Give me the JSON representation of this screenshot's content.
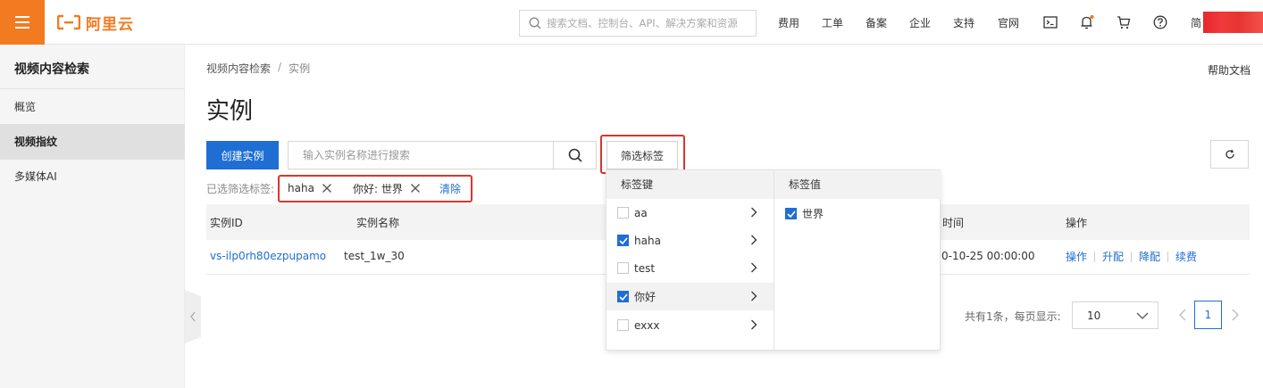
{
  "header": {
    "logo_text": "阿里云",
    "search_placeholder": "搜索文档、控制台、API、解决方案和资源",
    "nav": [
      "费用",
      "工单",
      "备案",
      "企业",
      "支持",
      "官网"
    ],
    "user_prefix": "简",
    "icons": [
      "terminal-icon",
      "bell-icon",
      "cart-icon",
      "help-icon"
    ],
    "accent_color": "#f27b21"
  },
  "sidebar": {
    "title": "视频内容检索",
    "items": [
      {
        "label": "概览",
        "active": false
      },
      {
        "label": "视频指纹",
        "active": true
      },
      {
        "label": "多媒体AI",
        "active": false
      }
    ]
  },
  "breadcrumb": {
    "parent": "视频内容检索",
    "separator": "/",
    "current": "实例"
  },
  "help_doc": "帮助文档",
  "page_title": "实例",
  "toolbar": {
    "create_label": "创建实例",
    "search_placeholder": "输入实例名称进行搜索",
    "filter_label": "筛选标签"
  },
  "selected_tags": {
    "label": "已选筛选标签:",
    "tags": [
      "haha",
      "你好: 世界"
    ],
    "clear_label": "清除"
  },
  "table": {
    "columns": [
      "实例ID",
      "实例名称",
      "时间",
      "操作"
    ],
    "rows": [
      {
        "id": "vs-ilp0rh80ezpupamo",
        "name": "test_1w_30",
        "time": "0-10-25 00:00:00",
        "ops": [
          "操作",
          "升配",
          "降配",
          "续费"
        ]
      }
    ]
  },
  "pagination": {
    "total_text": "共有1条，每页显示:",
    "page_size": "10",
    "current_page": "1"
  },
  "dropdown": {
    "key_header": "标签键",
    "value_header": "标签值",
    "keys": [
      {
        "label": "aa",
        "checked": false
      },
      {
        "label": "haha",
        "checked": true
      },
      {
        "label": "test",
        "checked": false
      },
      {
        "label": "你好",
        "checked": true
      },
      {
        "label": "exxx",
        "checked": false
      }
    ],
    "values": [
      {
        "label": "世界",
        "checked": true
      }
    ]
  }
}
